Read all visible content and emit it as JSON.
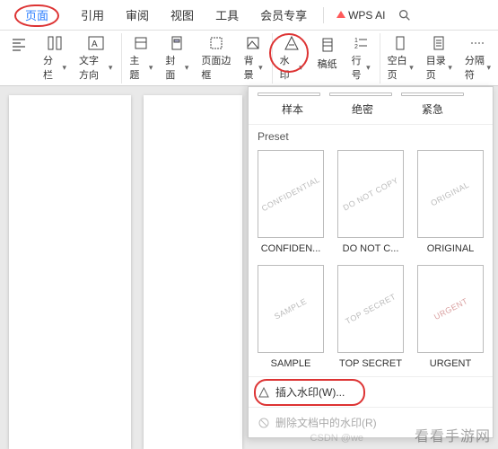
{
  "tabs": {
    "active": "页面",
    "items": [
      "页面",
      "引用",
      "审阅",
      "视图",
      "工具",
      "会员专享"
    ]
  },
  "brand": {
    "label": "WPS AI"
  },
  "ribbon": {
    "columns_icon": "分栏",
    "text_direction": "文字方向",
    "theme": "主题",
    "cover": "封面",
    "page_border": "页面边框",
    "background": "背景",
    "watermark": "水印",
    "letter_paper": "稿纸",
    "line_number": "行号",
    "blank_page": "空白页",
    "toc": "目录页",
    "separator": "分隔符"
  },
  "dropdown": {
    "cn_presets": [
      "样本",
      "绝密",
      "紧急"
    ],
    "preset_title": "Preset",
    "en_presets_row1_wm": [
      "CONFIDENTIAL",
      "DO NOT COPY",
      "ORIGINAL"
    ],
    "en_presets_row1_lbl": [
      "CONFIDEN...",
      "DO NOT C...",
      "ORIGINAL"
    ],
    "en_presets_row2_wm": [
      "SAMPLE",
      "TOP SECRET",
      "URGENT"
    ],
    "en_presets_row2_lbl": [
      "SAMPLE",
      "TOP SECRET",
      "URGENT"
    ],
    "insert_action": "插入水印(W)...",
    "remove_action": "删除文档中的水印(R)"
  },
  "footer": {
    "brand": "看看手游网",
    "sub": "CSDN @we"
  }
}
